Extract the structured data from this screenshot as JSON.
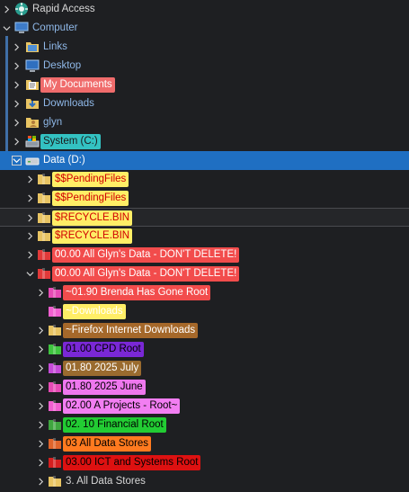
{
  "tree": {
    "rapid_access": "Rapid Access",
    "computer": "Computer",
    "computer_children": [
      {
        "label": "Links",
        "icon": "links-folder-icon",
        "color": null
      },
      {
        "label": "Desktop",
        "icon": "desktop-icon",
        "color": null
      },
      {
        "label": "My Documents",
        "icon": "documents-folder-icon",
        "color": "#f06c6c"
      },
      {
        "label": "Downloads",
        "icon": "downloads-folder-icon",
        "color": null
      },
      {
        "label": "glyn",
        "icon": "user-folder-icon",
        "color": null
      },
      {
        "label": "System (C:)",
        "icon": "system-drive-icon",
        "color": "#33c2c2"
      }
    ],
    "data_drive": "Data (D:)",
    "data_children": [
      {
        "label": "$$PendingFiles",
        "textColor": "#d00000",
        "bg": "#ffee66"
      },
      {
        "label": "$$PendingFiles",
        "textColor": "#d00000",
        "bg": "#ffee66"
      },
      {
        "label": "$RECYCLE.BIN",
        "textColor": "#d00000",
        "bg": "#ffee66"
      },
      {
        "label": "$RECYCLE.BIN",
        "textColor": "#d00000",
        "bg": "#ffee66"
      },
      {
        "label": "00.00 All Glyn's Data - DON'T DELETE!",
        "textColor": "#ffffff",
        "bg": "#f24c4c"
      },
      {
        "label": "00.00 All Glyn's Data - DON'T DELETE!",
        "textColor": "#ffffff",
        "bg": "#f24c4c"
      },
      {
        "label": "~01.90 Brenda Has Gone Root",
        "textColor": "#ffffff",
        "bg": "#f24c4c"
      },
      {
        "label": "~Downloads",
        "textColor": "#ffffff",
        "bg": "#ffee66"
      },
      {
        "label": "~Firefox Internet Downloads",
        "textColor": "#ffffff",
        "bg": "#a5682a"
      },
      {
        "label": "01.00 CPD Root",
        "textColor": "#000000",
        "bg": "#7a28d6"
      },
      {
        "label": "01.80 2025 July",
        "textColor": "#ffffff",
        "bg": "#9a6b2f"
      },
      {
        "label": "01.80 2025 June",
        "textColor": "#000000",
        "bg": "#ee77ee"
      },
      {
        "label": "02.00 A Projects - Root~",
        "textColor": "#000000",
        "bg": "#f27ef2"
      },
      {
        "label": "02. 10 Financial Root",
        "textColor": "#000000",
        "bg": "#22cc33"
      },
      {
        "label": "03 All Data Stores",
        "textColor": "#000000",
        "bg": "#ff7a1f"
      },
      {
        "label": "03.00 ICT and Systems Root",
        "textColor": "#000000",
        "bg": "#dd1111"
      },
      {
        "label": "3. All Data Stores",
        "textColor": "#d7d7d7",
        "bg": null
      }
    ]
  },
  "colors": {
    "background": "#1e1f22",
    "selection": "#1f6fc2",
    "accent_line": "#3f6fa7"
  }
}
